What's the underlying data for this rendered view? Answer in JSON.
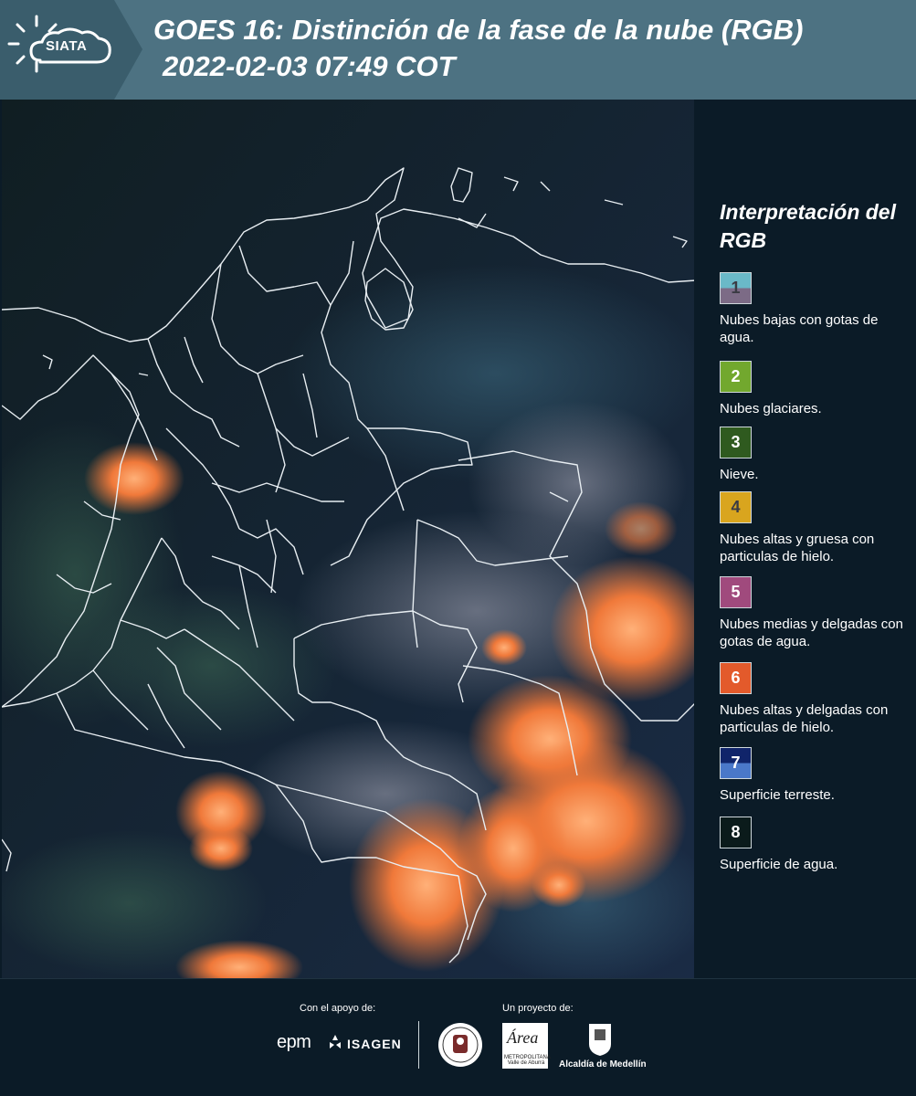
{
  "header": {
    "logo_text": "SIATA",
    "title": "GOES 16: Distinción de la fase de la nube (RGB)",
    "subtitle": "2022-02-03 07:49 COT"
  },
  "legend": {
    "title": "Interpretación del RGB",
    "items": [
      {
        "number": "1",
        "label": "Nubes bajas con gotas de agua.",
        "color_top": "#6ab9c8",
        "color_bottom": "#7c6b86"
      },
      {
        "number": "2",
        "label": "Nubes glaciares.",
        "color": "#72a82e"
      },
      {
        "number": "3",
        "label": "Nieve.",
        "color": "#2f5a1f"
      },
      {
        "number": "4",
        "label": "Nubes altas y gruesa con particulas de hielo.",
        "color": "#d9a51e"
      },
      {
        "number": "5",
        "label": "Nubes medias y delgadas con gotas de agua.",
        "color": "#a04a7d"
      },
      {
        "number": "6",
        "label": "Nubes altas y delgadas con particulas de hielo.",
        "color": "#e35a2b"
      },
      {
        "number": "7",
        "label": "Superficie terreste.",
        "color_top": "#10246a",
        "color_bottom": "#4a78c9"
      },
      {
        "number": "8",
        "label": "Superficie de agua.",
        "color": "#0b1b1b"
      }
    ]
  },
  "footer": {
    "support_label": "Con el apoyo de:",
    "project_label": "Un proyecto de:",
    "epm": "epm",
    "isagen": "ISAGEN",
    "area_word": "Área",
    "area_sub": "METROPOLITANA Valle de Aburrá",
    "alcaldia": "Alcaldía de Medellín"
  },
  "colors": {
    "header_bg": "#4d7282",
    "panel_bg": "#0b1b27",
    "cloud_ice": "#f07a3a"
  }
}
